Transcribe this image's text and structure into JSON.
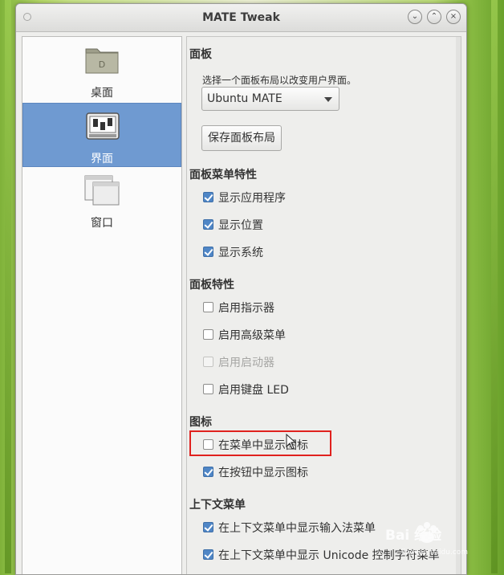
{
  "window": {
    "title": "MATE Tweak"
  },
  "sidebar": {
    "items": [
      {
        "label": "桌面",
        "icon": "folder-icon",
        "selected": false
      },
      {
        "label": "界面",
        "icon": "mixer-sliders-icon",
        "selected": true
      },
      {
        "label": "窗口",
        "icon": "window-icon",
        "selected": false
      }
    ]
  },
  "content": {
    "panel": {
      "heading": "面板",
      "hint": "选择一个面板布局以改变用户界面。",
      "layout_value": "Ubuntu MATE",
      "save_button": "保存面板布局"
    },
    "panel_menu_features": {
      "heading": "面板菜单特性",
      "options": [
        {
          "label": "显示应用程序",
          "checked": true
        },
        {
          "label": "显示位置",
          "checked": true
        },
        {
          "label": "显示系统",
          "checked": true
        }
      ]
    },
    "panel_features": {
      "heading": "面板特性",
      "options": [
        {
          "label": "启用指示器",
          "checked": false
        },
        {
          "label": "启用高级菜单",
          "checked": false
        },
        {
          "label": "启用启动器",
          "checked": false,
          "disabled": true
        },
        {
          "label": "启用键盘 LED",
          "checked": false
        }
      ]
    },
    "icons": {
      "heading": "图标",
      "options": [
        {
          "label": "在菜单中显示图标",
          "checked": false
        },
        {
          "label": "在按钮中显示图标",
          "checked": true
        }
      ]
    },
    "context_menu": {
      "heading": "上下文菜单",
      "options": [
        {
          "label": "在上下文菜单中显示输入法菜单",
          "checked": true
        },
        {
          "label": "在上下文菜单中显示 Unicode 控制字符菜单",
          "checked": true
        }
      ]
    }
  },
  "watermark": {
    "text": "Bai 经验",
    "subtext": "jingyan.baidu.com"
  },
  "colors": {
    "selection": "#6f9ad1",
    "checkbox_checked": "#4f86c6",
    "highlight_box": "#e0211e"
  }
}
